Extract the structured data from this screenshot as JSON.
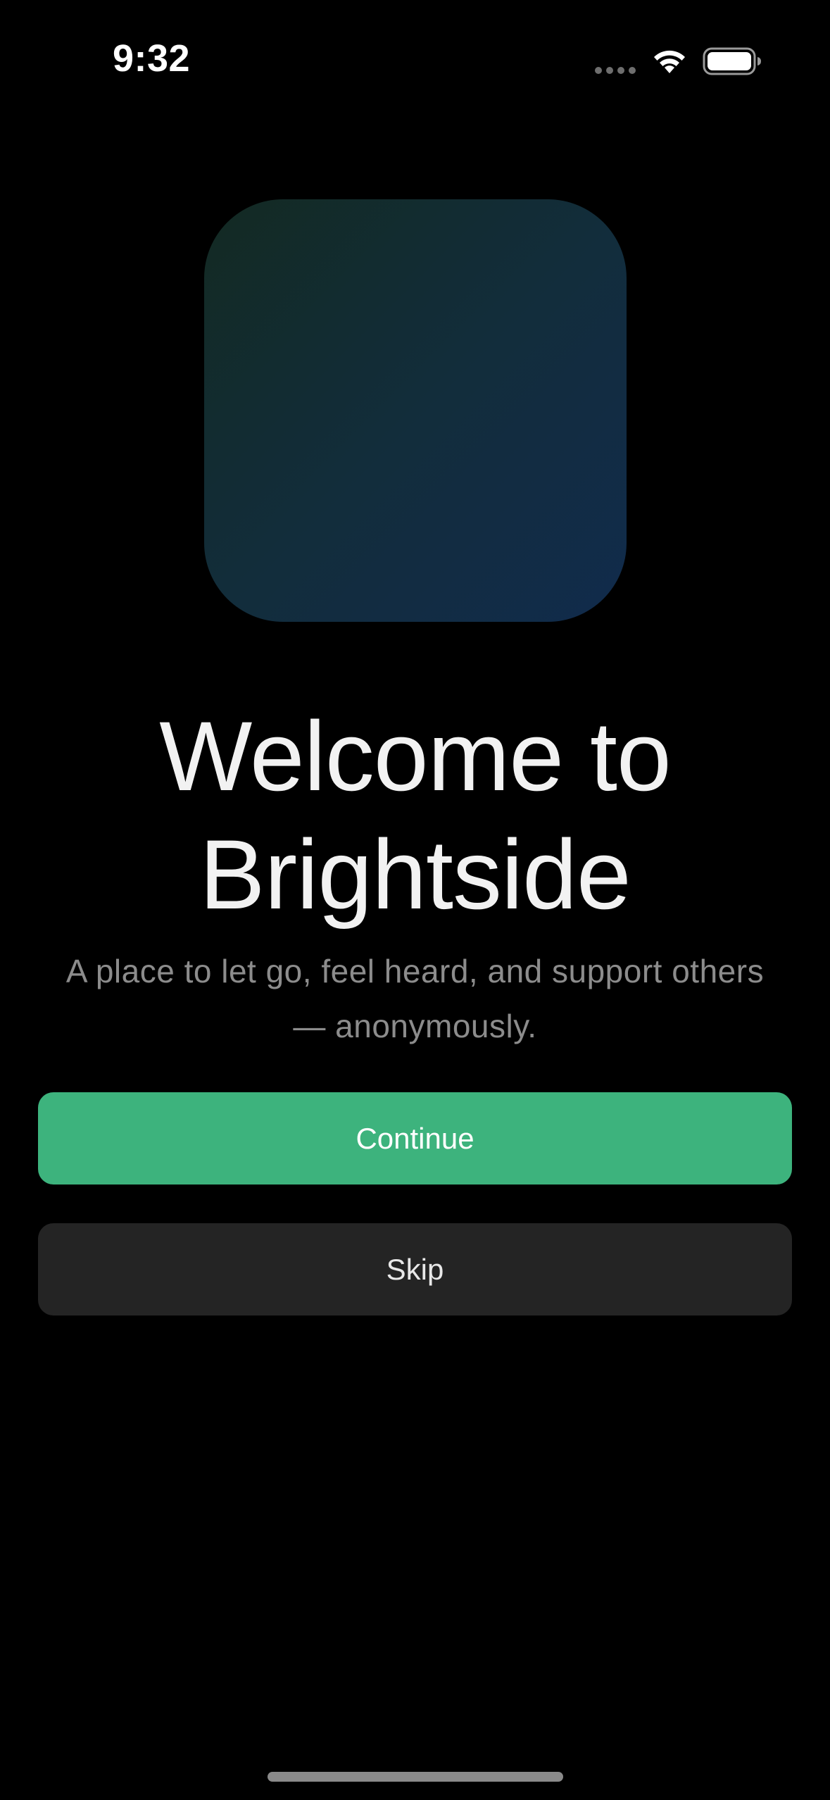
{
  "status_bar": {
    "time": "9:32",
    "icons": [
      "cellular-signal-icon",
      "wifi-icon",
      "battery-icon"
    ]
  },
  "welcome": {
    "app_icon": "app-icon",
    "title_line1": "Welcome to",
    "title_line2": "Brightside",
    "subtitle_line1": "A place to let go, feel heard, and support others",
    "subtitle_line2": "— anonymously."
  },
  "actions": {
    "continue_label": "Continue",
    "skip_label": "Skip"
  },
  "colors": {
    "background": "#000000",
    "accent": "#3db37d",
    "secondary_button": "#242424",
    "subtitle_text": "#8c8c8c"
  }
}
